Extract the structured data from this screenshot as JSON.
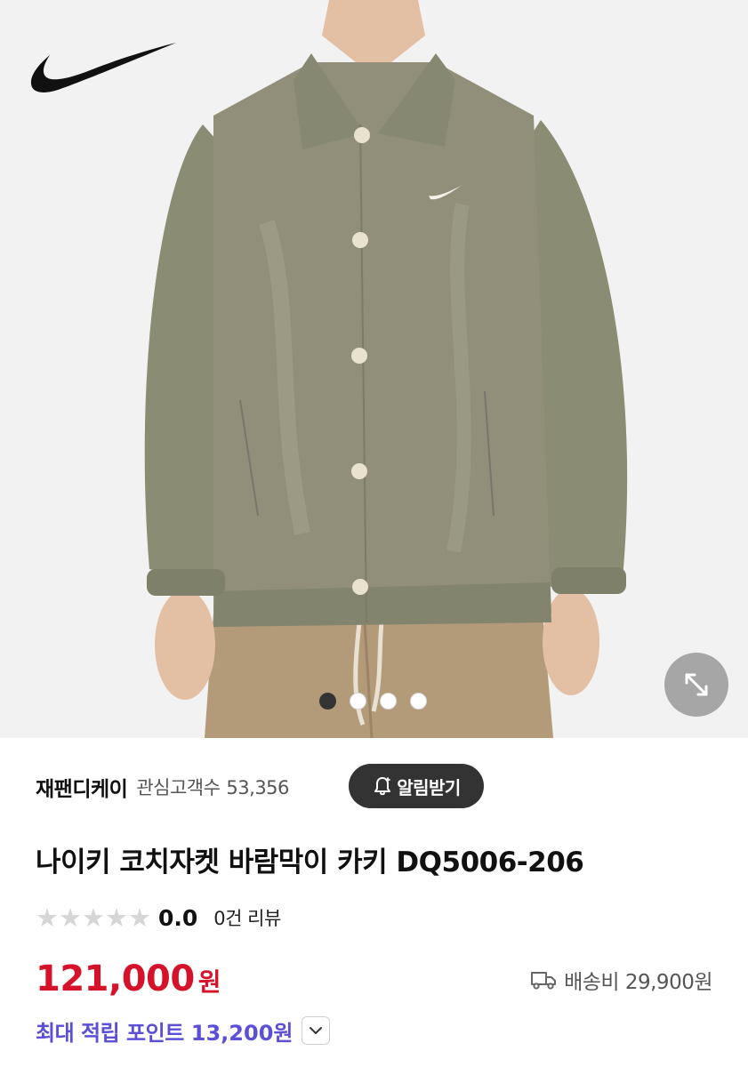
{
  "hero": {
    "brand": "nike-swoosh-logo",
    "carousel": {
      "total": 4,
      "active_index": 0
    },
    "expand_icon": "expand-diagonal-icon"
  },
  "seller": {
    "name": "재팬디케이",
    "followers_label": "관심고객수",
    "followers_count": "53,356",
    "alert_button": "알림받기",
    "alert_icon": "bell-plus-icon"
  },
  "product": {
    "title": "나이키 코치자켓 바람막이 카키 DQ5006-206",
    "rating": {
      "stars_filled": 0,
      "stars_total": 5,
      "score": "0.0",
      "reviews": "0건 리뷰"
    },
    "price": {
      "amount": "121,000",
      "unit": "원"
    },
    "shipping": {
      "label": "배송비 29,900원",
      "icon": "truck-icon"
    },
    "points": {
      "label": "최대 적립 포인트",
      "value": "13,200원",
      "icon": "chevron-down-icon"
    }
  },
  "colors": {
    "price_red": "#d6112a",
    "points_purple": "#5b4fd6",
    "button_dark": "#333333",
    "jacket_khaki": "#8f9179"
  }
}
